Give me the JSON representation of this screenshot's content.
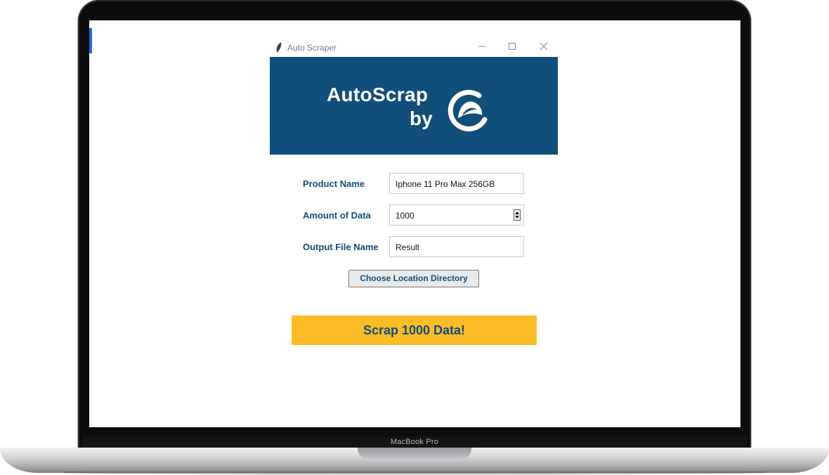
{
  "device": {
    "model_label": "MacBook Pro"
  },
  "window": {
    "title": "Auto Scraper",
    "controls": [
      "minimize",
      "maximize",
      "close"
    ]
  },
  "banner": {
    "line1": "AutoScrap",
    "line2": "by",
    "background": "#114e79",
    "logo_icon": "brand-logo-icon"
  },
  "form": {
    "product_name": {
      "label": "Product Name",
      "value": "Iphone 11 Pro Max 256GB"
    },
    "amount_of_data": {
      "label": "Amount of Data",
      "value": "1000"
    },
    "output_file_name": {
      "label": "Output File Name",
      "value": "Result"
    }
  },
  "buttons": {
    "choose_location": "Choose Location Directory",
    "scrap": "Scrap 1000 Data!"
  },
  "colors": {
    "accent_blue": "#114e79",
    "accent_yellow": "#fbbc27"
  }
}
